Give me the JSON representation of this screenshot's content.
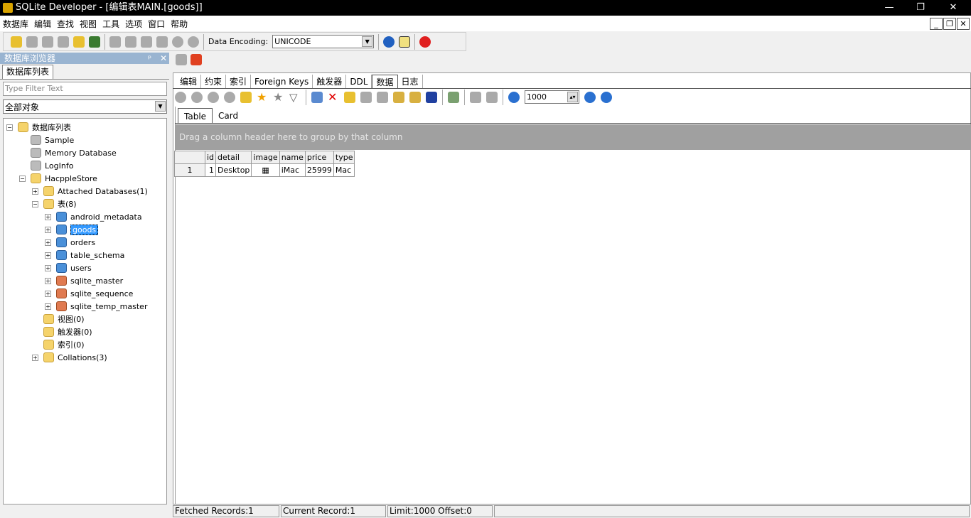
{
  "window": {
    "title": "SQLite Developer - [编辑表MAIN.[goods]]",
    "minimize": "—",
    "restore": "❐",
    "close": "✕"
  },
  "menu": [
    "数据库",
    "编辑",
    "查找",
    "视图",
    "工具",
    "选项",
    "窗口",
    "帮助"
  ],
  "mdi_buttons": [
    "_",
    "❐",
    "✕"
  ],
  "toolbar": {
    "encoding_label": "Data Encoding:",
    "encoding_value": "UNICODE"
  },
  "browser": {
    "title": "数据库浏览器",
    "pin": "ᵖ",
    "close": "✕",
    "tab": "数据库列表",
    "filter_placeholder": "Type Filter Text",
    "object_filter": "全部对象",
    "tree": [
      {
        "label": "数据库列表",
        "level": 0,
        "toggle": "−",
        "icon": "db-search"
      },
      {
        "label": "Sample",
        "level": 1,
        "icon": "db"
      },
      {
        "label": "Memory Database",
        "level": 1,
        "icon": "memory"
      },
      {
        "label": "LogInfo",
        "level": 1,
        "icon": "db"
      },
      {
        "label": "HacppleStore",
        "level": 1,
        "toggle": "−",
        "icon": "db-open"
      },
      {
        "label": "Attached Databases(1)",
        "level": 2,
        "toggle": "+",
        "icon": "folder"
      },
      {
        "label": "表(8)",
        "level": 2,
        "toggle": "−",
        "icon": "folder"
      },
      {
        "label": "android_metadata",
        "level": 3,
        "toggle": "+",
        "icon": "table"
      },
      {
        "label": "goods",
        "level": 3,
        "toggle": "+",
        "icon": "table",
        "selected": true
      },
      {
        "label": "orders",
        "level": 3,
        "toggle": "+",
        "icon": "table"
      },
      {
        "label": "table_schema",
        "level": 3,
        "toggle": "+",
        "icon": "table"
      },
      {
        "label": "users",
        "level": 3,
        "toggle": "+",
        "icon": "table"
      },
      {
        "label": "sqlite_master",
        "level": 3,
        "toggle": "+",
        "icon": "system-table"
      },
      {
        "label": "sqlite_sequence",
        "level": 3,
        "toggle": "+",
        "icon": "system-table"
      },
      {
        "label": "sqlite_temp_master",
        "level": 3,
        "toggle": "+",
        "icon": "system-table"
      },
      {
        "label": "视图(0)",
        "level": 2,
        "icon": "folder"
      },
      {
        "label": "触发器(0)",
        "level": 2,
        "icon": "folder"
      },
      {
        "label": "索引(0)",
        "level": 2,
        "icon": "folder"
      },
      {
        "label": "Collations(3)",
        "level": 2,
        "toggle": "+",
        "icon": "folder"
      }
    ]
  },
  "editor": {
    "tabs": [
      "编辑",
      "约束",
      "索引",
      "Foreign Keys",
      "触发器",
      "DDL",
      "数据",
      "日志"
    ],
    "active_tab": "数据",
    "limit_value": "1000",
    "subtabs": [
      "Table",
      "Card"
    ],
    "active_subtab": "Table",
    "group_hint": "Drag a column header here to group by that column",
    "columns": [
      "id",
      "detail",
      "image",
      "name",
      "price",
      "type"
    ],
    "rows": [
      {
        "rownum": "1",
        "cells": [
          "1",
          "Desktop",
          "▦",
          "iMac",
          "25999",
          "Mac"
        ]
      }
    ]
  },
  "status": {
    "fetched": "Fetched Records:1",
    "current": "Current Record:1",
    "limit": "Limit:1000 Offset:0"
  }
}
